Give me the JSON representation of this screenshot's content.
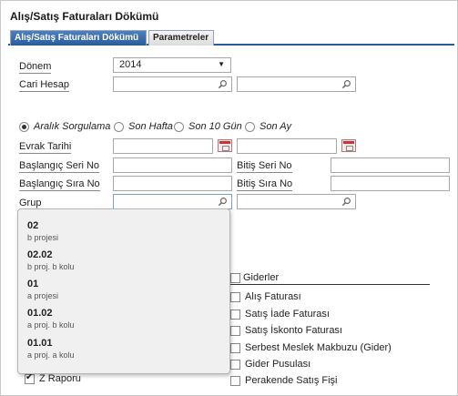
{
  "window": {
    "title": "Alış/Satış Faturaları Dökümü"
  },
  "tabs": [
    {
      "label": "Alış/Satış Faturaları Dökümü"
    },
    {
      "label": "Parametreler"
    }
  ],
  "form": {
    "donem": {
      "label": "Dönem",
      "value": "2014"
    },
    "cari_hesap": {
      "label": "Cari Hesap"
    },
    "range_options": [
      "Aralık Sorgulama",
      "Son Hafta",
      "Son 10 Gün",
      "Son Ay"
    ],
    "evrak_tarihi": {
      "label": "Evrak Tarihi"
    },
    "baslangic_seri": {
      "label": "Başlangıç Seri No"
    },
    "bitis_seri": {
      "label": "Bitiş Seri No"
    },
    "baslangic_sira": {
      "label": "Başlangıç Sıra No"
    },
    "bitis_sira": {
      "label": "Bitiş Sıra No"
    },
    "grup": {
      "label": "Grup"
    }
  },
  "dropdown": {
    "items": [
      {
        "code": "02",
        "name": "b projesi"
      },
      {
        "code": "02.02",
        "name": "b proj. b kolu"
      },
      {
        "code": "01",
        "name": "a projesi"
      },
      {
        "code": "01.02",
        "name": "a proj. b kolu"
      },
      {
        "code": "01.01",
        "name": "a proj. a kolu"
      }
    ]
  },
  "giderler": {
    "header": "Giderler",
    "items": [
      "Alış Faturası",
      "Satış İade Faturası",
      "Satış İskonto Faturası",
      "Serbest Meslek Makbuzu (Gider)",
      "Gider Pusulası",
      "Perakende Satış Fişi"
    ]
  },
  "z_raporu": {
    "label": "Z Raporu",
    "checked": true
  }
}
